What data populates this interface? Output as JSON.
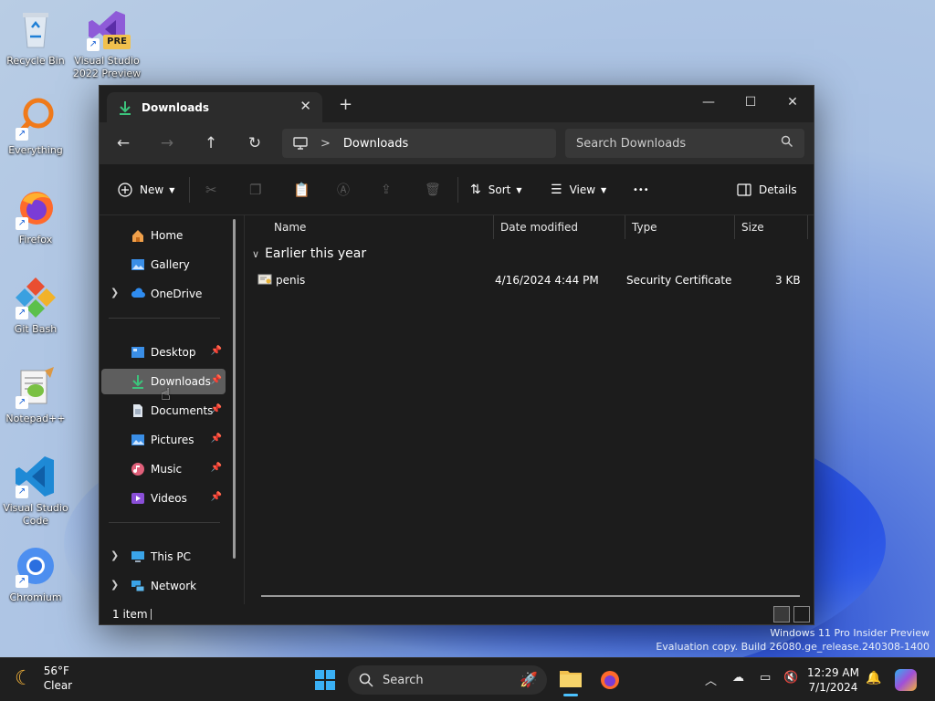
{
  "desktop": {
    "icons": [
      {
        "label": "Recycle Bin"
      },
      {
        "label": "Visual Studio 2022 Preview",
        "badge": "PRE"
      },
      {
        "label": "Everything"
      },
      {
        "label": "Firefox"
      },
      {
        "label": "Git Bash"
      },
      {
        "label": "Notepad++"
      },
      {
        "label": "Visual Studio Code"
      },
      {
        "label": "Chromium"
      }
    ],
    "watermark": {
      "line1": "Windows 11 Pro Insider Preview",
      "line2": "Evaluation copy. Build 26080.ge_release.240308-1400"
    }
  },
  "explorer": {
    "tab": {
      "title": "Downloads",
      "close": "✕",
      "new": "+"
    },
    "window_controls": {
      "minimize": "—",
      "maximize": "☐",
      "close": "✕"
    },
    "nav": {
      "back": "←",
      "forward": "→",
      "up": "↑",
      "refresh": "↻"
    },
    "address": {
      "sep": ">",
      "crumb": "Downloads"
    },
    "search": {
      "placeholder": "Search Downloads"
    },
    "toolbar": {
      "new": "New",
      "sort": "Sort",
      "view": "View",
      "more": "•••",
      "details": "Details"
    },
    "sidebar": {
      "home": "Home",
      "gallery": "Gallery",
      "onedrive": "OneDrive",
      "desktop": "Desktop",
      "downloads": "Downloads",
      "documents": "Documents",
      "pictures": "Pictures",
      "music": "Music",
      "videos": "Videos",
      "thispc": "This PC",
      "network": "Network"
    },
    "columns": {
      "name": "Name",
      "date": "Date modified",
      "type": "Type",
      "size": "Size"
    },
    "group": "Earlier this year",
    "files": [
      {
        "name": "penis",
        "date": "4/16/2024 4:44 PM",
        "type": "Security Certificate",
        "size": "3 KB"
      }
    ],
    "status": {
      "count": "1 item"
    }
  },
  "taskbar": {
    "weather": {
      "temp": "56°F",
      "condition": "Clear"
    },
    "search": "Search",
    "clock": {
      "time": "12:29 AM",
      "date": "7/1/2024"
    }
  }
}
